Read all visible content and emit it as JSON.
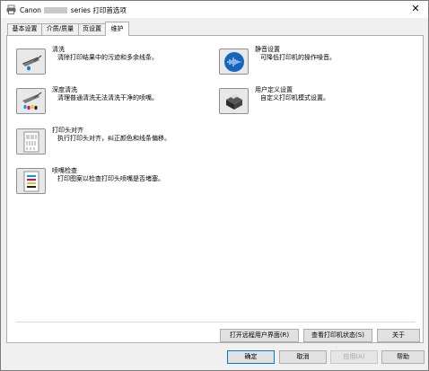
{
  "window": {
    "title_prefix": "Canon",
    "title_suffix": "series 打印首选项",
    "close_glyph": "✕"
  },
  "tabs": [
    {
      "label": "基本设置"
    },
    {
      "label": "介质/质量"
    },
    {
      "label": "页设置"
    },
    {
      "label": "维护"
    }
  ],
  "functions": {
    "cleaning": {
      "title": "清洗",
      "desc": "清除打印结果中的污迹和多余线条。",
      "icon": "cleaning-icon"
    },
    "deep_cleaning": {
      "title": "深度清洗",
      "desc": "清理普通清洗无法清洗干净的喷嘴。",
      "icon": "deep-cleaning-icon"
    },
    "alignment": {
      "title": "打印头对齐",
      "desc": "执行打印头对齐，纠正颜色和线条偏移。",
      "icon": "print-head-alignment-icon"
    },
    "nozzle_check": {
      "title": "喷嘴检查",
      "desc": "打印图案以检查打印头喷嘴是否堵塞。",
      "icon": "nozzle-check-icon"
    },
    "quiet": {
      "title": "静音设置",
      "desc": "可降低打印机的操作噪音。",
      "icon": "quiet-settings-icon"
    },
    "custom": {
      "title": "用户定义设置",
      "desc": "自定义打印机模式设置。",
      "icon": "custom-settings-icon"
    }
  },
  "panel_buttons": {
    "remote_ui": "打开远程用户界面(R)",
    "status": "查看打印机状态(S)",
    "about": "关于"
  },
  "dialog_buttons": {
    "ok": "确定",
    "cancel": "取消",
    "apply": "应用(A)",
    "help": "帮助"
  }
}
